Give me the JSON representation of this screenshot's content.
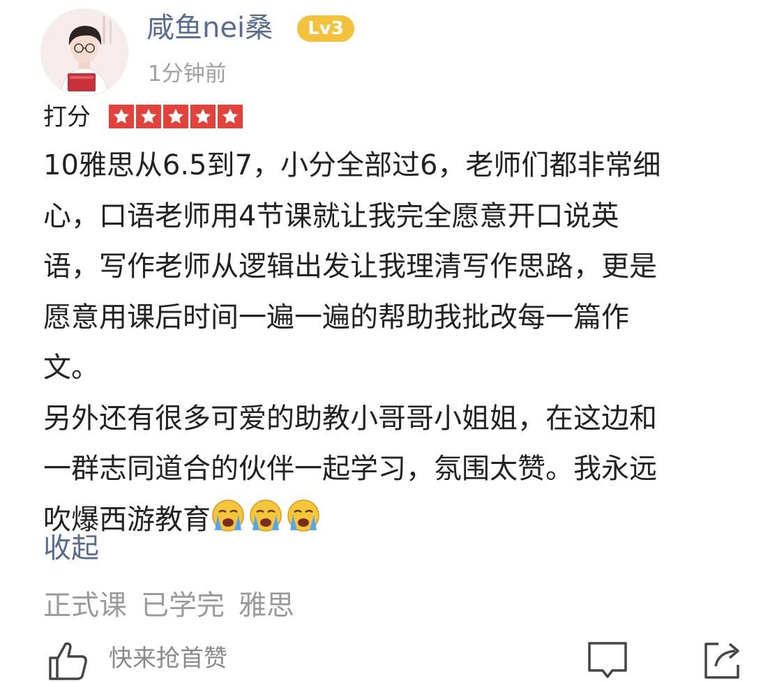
{
  "user": {
    "name": "咸鱼nei桑",
    "level": "Lv3",
    "time": "1分钟前"
  },
  "rating": {
    "label": "打分",
    "stars": 5,
    "max": 5
  },
  "review": {
    "lines": [
      "10雅思从6.5到7，小分全部过6，老师们都非常细",
      "心，口语老师用4节课就让我完全愿意开口说英",
      "语，写作老师从逻辑出发让我理清写作思路，更是",
      "愿意用课后时间一遍一遍的帮助我批改每一篇作",
      "文。",
      "另外还有很多可爱的助教小哥哥小姐姐，在这边和",
      "一群志同道合的伙伴一起学习，氛围太赞。我永远",
      "吹爆西游教育"
    ],
    "emoji": [
      "crying-face-icon",
      "crying-face-icon",
      "crying-face-icon"
    ]
  },
  "collapse_label": "收起",
  "tags": [
    "正式课",
    "已学完",
    "雅思"
  ],
  "footer": {
    "like_label": "快来抢首赞"
  },
  "colors": {
    "link": "#576b95",
    "badge": "#f4c23a",
    "star_bg": "#e2423a",
    "muted": "#9a9a9a"
  }
}
